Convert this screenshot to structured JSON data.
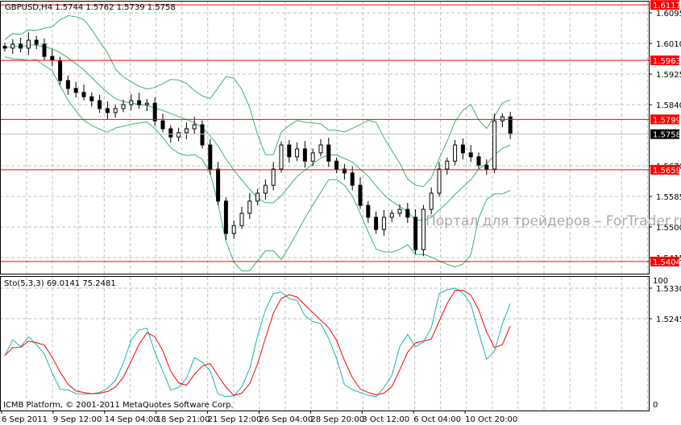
{
  "chart_data": [
    {
      "type": "candlestick",
      "symbol_label": "GBPUSD,H4",
      "ohlc_label": "1.5744 1.5762 1.5739 1.5758",
      "ylim": [
        1.5245,
        1.6117
      ],
      "y_ticks": [
        "1.6095",
        "1.6010",
        "1.5925",
        "1.5840",
        "1.5670",
        "1.5585",
        "1.5500",
        "1.5415",
        "1.5330",
        "1.5245"
      ],
      "grid": true,
      "closes": [
        1.5997,
        1.6008,
        1.5997,
        1.6019,
        1.6008,
        1.5974,
        1.5963,
        1.5907,
        1.5885,
        1.5874,
        1.5862,
        1.5851,
        1.5829,
        1.5818,
        1.5829,
        1.584,
        1.5851,
        1.584,
        1.5844,
        1.5795,
        1.5773,
        1.575,
        1.5762,
        1.5773,
        1.5784,
        1.5728,
        1.5661,
        1.5572,
        1.5482,
        1.5504,
        1.5538,
        1.5572,
        1.5594,
        1.5616,
        1.5661,
        1.5728,
        1.5695,
        1.5717,
        1.5683,
        1.5706,
        1.5728,
        1.5683,
        1.5661,
        1.565,
        1.5616,
        1.556,
        1.5527,
        1.5493,
        1.5527,
        1.5538,
        1.5549,
        1.5527,
        1.5437,
        1.5549,
        1.5594,
        1.5661,
        1.5683,
        1.5728,
        1.5706,
        1.5695,
        1.5672,
        1.5661,
        1.5795,
        1.5806,
        1.5758
      ],
      "overlay": "Bollinger Bands",
      "horizontal_levels": [
        {
          "price": "1.6117",
          "color": "#ff0000"
        },
        {
          "price": "1.5963",
          "color": "#ff0000"
        },
        {
          "price": "1.5799",
          "color": "#ff0000"
        },
        {
          "price": "1.5659",
          "color": "#ff0000"
        },
        {
          "price": "1.5404",
          "color": "#ff0000"
        }
      ],
      "current_price": "1.5758",
      "colors": {
        "bands": "#3cb371",
        "level": "#ff0000",
        "current_price_bg": "#000000"
      }
    },
    {
      "type": "line",
      "indicator_label": "Sto(5,3,3) 69.0141 75.2481",
      "ylim": [
        0,
        100
      ],
      "y_ticks": [
        "100",
        "0"
      ],
      "series_colors": {
        "main": "#20b2aa",
        "signal": "#ff0000"
      }
    }
  ],
  "x_ticks": [
    "6 Sep 2011",
    "9 Sep 12:00",
    "14 Sep 04:00",
    "18 Sep 21:00",
    "21 Sep 12:00",
    "26 Sep 04:00",
    "28 Sep 20:00",
    "3 Oct 12:00",
    "6 Oct 04:00",
    "10 Oct 20:00"
  ],
  "watermark": "Портал для трейдеров – ForTrader.ru",
  "copyright": "ICMB Platform, © 2001-2011 MetaQuotes Software Corp."
}
